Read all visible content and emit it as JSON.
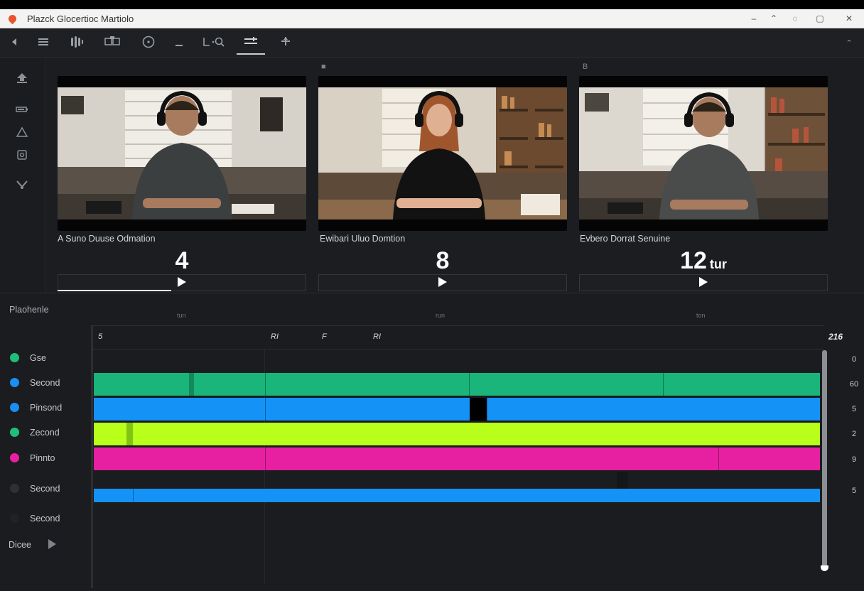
{
  "window": {
    "title": "Plazck Glocertioc Martiolo",
    "controls": [
      "–",
      "⌃",
      "◌",
      "▢",
      "✕"
    ]
  },
  "toolbar": {
    "icons": [
      "back-icon",
      "menu-icon",
      "audio-waveform-icon",
      "split-icon",
      "clock-icon",
      "minus-icon",
      "search-icon",
      "align-icon",
      "add-icon"
    ],
    "right_glyph": "⌃"
  },
  "sidebar": {
    "icons": [
      "upload-icon",
      "battery-icon",
      "triangle-icon",
      "clip-icon",
      "scissors-icon"
    ]
  },
  "panels": [
    {
      "mark": "",
      "caption": "A Suno Duuse Odmation",
      "number": "4",
      "unit": "",
      "person": "man"
    },
    {
      "mark": "■",
      "caption": "Ewibari Uluo Domtion",
      "number": "8",
      "unit": "",
      "person": "woman"
    },
    {
      "mark": "B",
      "caption": "Evbero Dorrat Senuine",
      "number": "12",
      "unit": "tur",
      "person": "man"
    }
  ],
  "timeline": {
    "heading": "Plaohenle",
    "top_labels": [
      "tun",
      "run",
      "ton"
    ],
    "ticks": [
      "5",
      "RI",
      "F",
      "RI"
    ],
    "end_label": "216",
    "tracks": [
      {
        "name": "Gse",
        "color": "#1fbf7a",
        "value": "0",
        "clip_color": "#1ab57a"
      },
      {
        "name": "Second",
        "color": "#1b8ef0",
        "value": "60",
        "clip_color": "#1592f5"
      },
      {
        "name": "Pinsond",
        "color": "#1b8ef0",
        "value": "5",
        "clip_color": "#1592f5"
      },
      {
        "name": "Zecond",
        "color": "#1fbf7a",
        "value": "2",
        "clip_color": "#b8ff1a"
      },
      {
        "name": "Pinnto",
        "color": "#e81fa0",
        "value": "9",
        "clip_color": "#e620a0"
      },
      {
        "name": "Second",
        "color": "#2d3034",
        "value": "5",
        "clip_color": "#1592f5"
      },
      {
        "name": "Second",
        "color": "#202226",
        "value": "",
        "clip_color": ""
      }
    ],
    "footer_label": "Dicee"
  },
  "colors": {
    "background": "#1a1c1f",
    "green": "#1ab57a",
    "blue": "#1592f5",
    "lime": "#b8ff1a",
    "magenta": "#e620a0"
  }
}
